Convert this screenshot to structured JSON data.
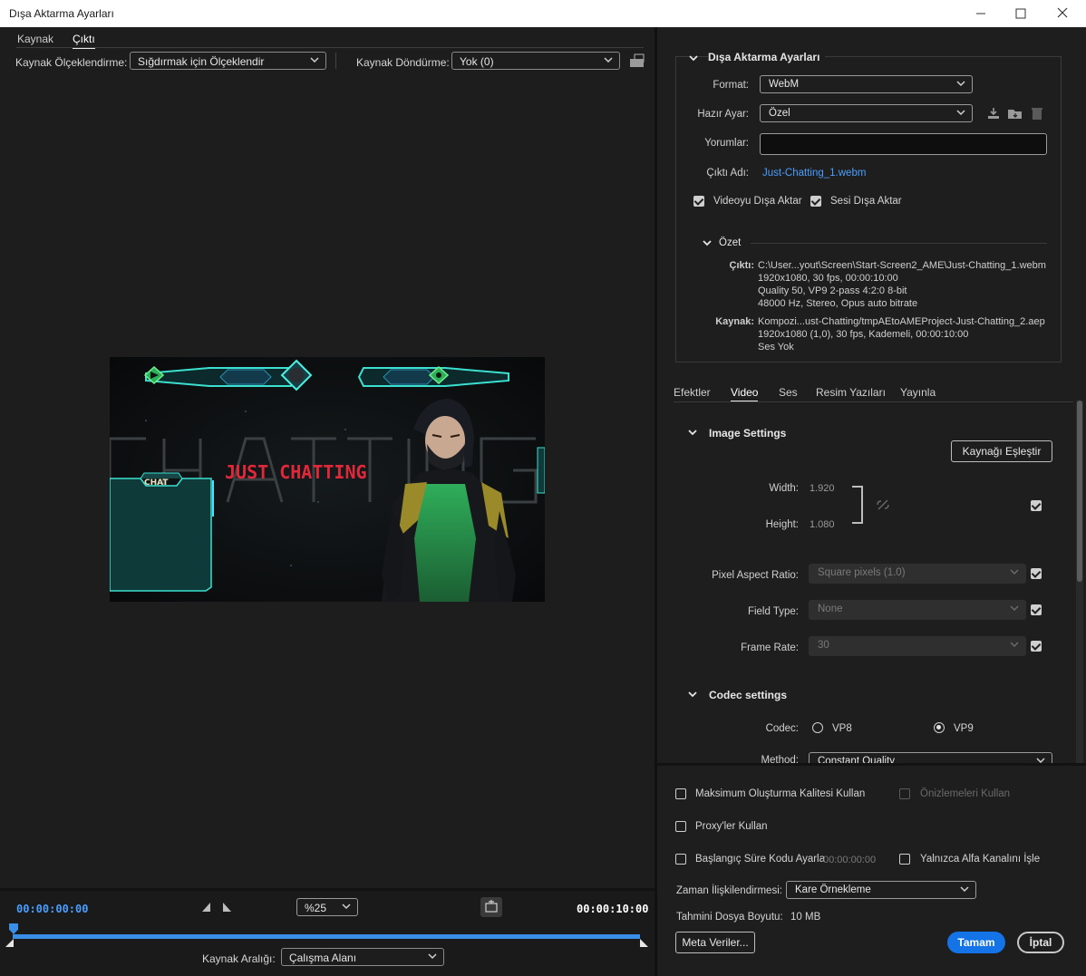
{
  "window": {
    "title": "Dışa Aktarma Ayarları"
  },
  "left": {
    "tabs": [
      "Kaynak",
      "Çıktı"
    ],
    "active_tab": "Çıktı",
    "scaling_label": "Kaynak Ölçeklendirme:",
    "scaling_value": "Sığdırmak için Ölçeklendir",
    "rotation_label": "Kaynak Döndürme:",
    "rotation_value": "Yok (0)",
    "preview": {
      "banner_text": "JUST CHATTING",
      "bg_text": "CHATTING",
      "chat_label": "CHAT"
    },
    "timeline": {
      "start_tc": "00:00:00:00",
      "end_tc": "00:00:10:00",
      "zoom": "%25",
      "range_label": "Kaynak Aralığı:",
      "range_value": "Çalışma Alanı",
      "playhead_progress": 0
    }
  },
  "right": {
    "group_title": "Dışa Aktarma Ayarları",
    "format_label": "Format:",
    "format_value": "WebM",
    "preset_label": "Hazır Ayar:",
    "preset_value": "Özel",
    "comments_label": "Yorumlar:",
    "comments_value": "",
    "output_name_label": "Çıktı Adı:",
    "output_name_value": "Just-Chatting_1.webm",
    "export_video_label": "Videoyu Dışa Aktar",
    "export_audio_label": "Sesi Dışa Aktar",
    "summary": {
      "title": "Özet",
      "output_label": "Çıktı:",
      "output_lines": [
        "C:\\User...yout\\Screen\\Start-Screen2_AME\\Just-Chatting_1.webm",
        "1920x1080, 30 fps, 00:00:10:00",
        "Quality 50, VP9 2-pass 4:2:0 8-bit",
        "48000 Hz, Stereo, Opus auto bitrate"
      ],
      "source_label": "Kaynak:",
      "source_lines": [
        "Kompozi...ust-Chatting/tmpAEtoAMEProject-Just-Chatting_2.aep",
        "1920x1080 (1,0), 30 fps, Kademeli, 00:00:10:00",
        "Ses Yok"
      ]
    },
    "tabs": [
      "Efektler",
      "Video",
      "Ses",
      "Resim Yazıları",
      "Yayınla"
    ],
    "active_tab": "Video",
    "image_settings": {
      "title": "Image Settings",
      "match_source": "Kaynağı Eşleştir",
      "width_label": "Width:",
      "width_value": "1.920",
      "height_label": "Height:",
      "height_value": "1.080",
      "par_label": "Pixel Aspect Ratio:",
      "par_value": "Square pixels (1.0)",
      "field_label": "Field Type:",
      "field_value": "None",
      "fps_label": "Frame Rate:",
      "fps_value": "30"
    },
    "codec_settings": {
      "title": "Codec settings",
      "codec_label": "Codec:",
      "options": [
        "VP8",
        "VP9"
      ],
      "selected": "VP9",
      "method_label": "Method:",
      "method_value": "Constant Quality"
    },
    "bottom": {
      "max_quality": "Maksimum Oluşturma Kalitesi Kullan",
      "use_previews": "Önizlemeleri Kullan",
      "use_proxies": "Proxy'ler Kullan",
      "start_tc_label": "Başlangıç Süre Kodu Ayarla",
      "start_tc_value": "00:00:00:00",
      "alpha_only": "Yalnızca Alfa Kanalını İşle",
      "time_interp_label": "Zaman İlişkilendirmesi:",
      "time_interp_value": "Kare Örnekleme",
      "est_size_label": "Tahmini Dosya Boyutu:",
      "est_size_value": "10 MB",
      "metadata_btn": "Meta Veriler...",
      "ok_btn": "Tamam",
      "cancel_btn": "İptal"
    }
  },
  "colors": {
    "accent": "#1473e6",
    "link": "#4a9eff",
    "timeline": "#3a8ee6",
    "banner_red": "#e0283a",
    "neon": "#3be0d0",
    "green": "#2fae5a"
  }
}
